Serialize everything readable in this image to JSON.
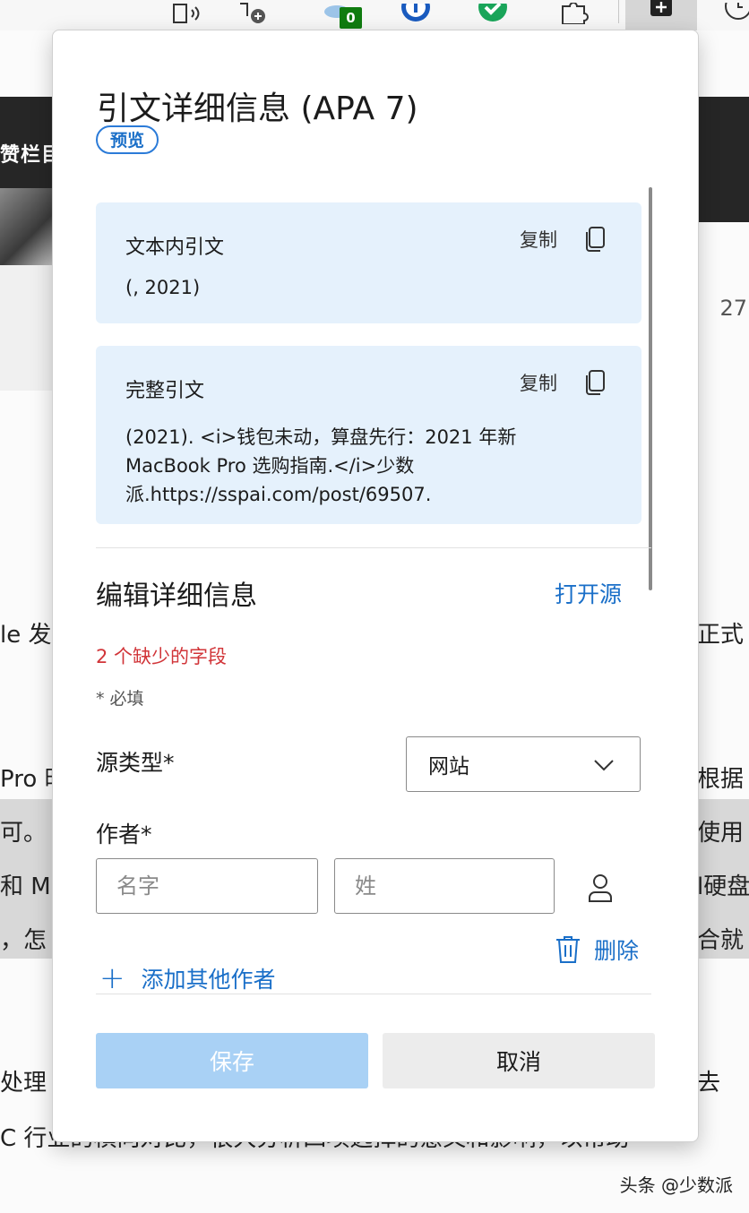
{
  "toolbar": {
    "badge_count": "0"
  },
  "background": {
    "band_text": "赞栏目",
    "num_27": "27",
    "left_fragments": [
      "le 发",
      "Pro 时",
      "可。",
      "和 M",
      "，怎",
      "处理",
      "C 行业的横向对比，很大分析四项选择的意义和影响，以帮助"
    ],
    "right_fragments": [
      "正式",
      "根据",
      "使用",
      "l硬盘",
      "合就",
      "去"
    ],
    "watermark": "头条 @少数派"
  },
  "popup": {
    "title": "引文详细信息 (APA 7)",
    "badge": "预览",
    "intext": {
      "label": "文本内引文",
      "copy": "复制",
      "text": "(, 2021)"
    },
    "full": {
      "label": "完整引文",
      "copy": "复制",
      "line1": "(2021). <i>钱包未动，算盘先行：2021 年新",
      "line2": "MacBook Pro 选购指南.</i>少数",
      "line3": "派.https://sspai.com/post/69507."
    },
    "edit": {
      "title": "编辑详细信息",
      "open_source": "打开源",
      "missing": "2 个缺少的字段",
      "required": "* 必填",
      "source_type_label": "源类型*",
      "source_type_value": "网站",
      "author_label": "作者*",
      "first_name_placeholder": "名字",
      "last_name_placeholder": "姓",
      "delete": "删除",
      "add_author": "添加其他作者"
    },
    "buttons": {
      "save": "保存",
      "cancel": "取消"
    }
  },
  "colors": {
    "accent": "#1a6fc8",
    "card_bg": "#e5f1fc",
    "error": "#d13438",
    "save_disabled": "#a9d1f5"
  }
}
